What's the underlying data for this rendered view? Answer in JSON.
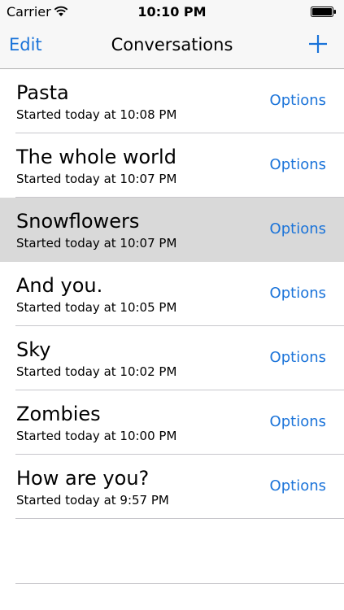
{
  "status_bar": {
    "carrier": "Carrier",
    "time": "10:10 PM"
  },
  "nav": {
    "edit_label": "Edit",
    "title": "Conversations",
    "add_icon": "plus-icon"
  },
  "colors": {
    "accent": "#1a73d9",
    "selected_row": "#d9d9d9",
    "separator": "#c8c7cc"
  },
  "conversations": [
    {
      "title": "Pasta",
      "subtitle": "Started today at 10:08 PM",
      "options_label": "Options",
      "selected": false
    },
    {
      "title": "The whole world",
      "subtitle": "Started today at 10:07 PM",
      "options_label": "Options",
      "selected": false
    },
    {
      "title": "Snowflowers",
      "subtitle": "Started today at 10:07 PM",
      "options_label": "Options",
      "selected": true
    },
    {
      "title": "And you.",
      "subtitle": "Started today at 10:05 PM",
      "options_label": "Options",
      "selected": false
    },
    {
      "title": "Sky",
      "subtitle": "Started today at 10:02 PM",
      "options_label": "Options",
      "selected": false
    },
    {
      "title": "Zombies",
      "subtitle": "Started today at 10:00 PM",
      "options_label": "Options",
      "selected": false
    },
    {
      "title": "How are you?",
      "subtitle": "Started today at 9:57 PM",
      "options_label": "Options",
      "selected": false
    }
  ]
}
